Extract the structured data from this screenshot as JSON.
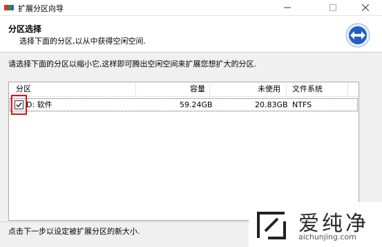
{
  "window": {
    "title": "扩展分区向导"
  },
  "header": {
    "title": "分区选择",
    "subtitle": "选择下面的分区,以从中获得空闲空间."
  },
  "instruction": "请选择下面的分区以缩小它,这样即可腾出空闲空间来扩展您想扩大的分区.",
  "table": {
    "columns": [
      "分区",
      "容量",
      "未使用",
      "文件系统"
    ],
    "rows": [
      {
        "checked": true,
        "partition": "D: 软件",
        "capacity": "59.24GB",
        "unused": "20.83GB",
        "filesystem": "NTFS"
      }
    ]
  },
  "footer": "点击下一步以设定被扩展分区的新大小.",
  "watermark": {
    "text": "爱纯净",
    "url": "aichunjing.com"
  },
  "colors": {
    "highlight_box": "#dd1111",
    "nav_icon": "#1f5fbf"
  }
}
